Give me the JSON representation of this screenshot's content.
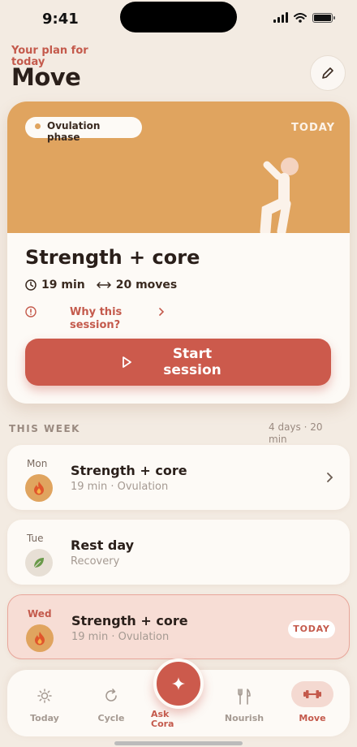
{
  "status_bar": {
    "time": "9:41"
  },
  "header": {
    "eyebrow": "Your plan for today",
    "title": "Move",
    "edit_icon": "pencil-icon"
  },
  "hero": {
    "phase": "Ovulation phase",
    "badge": "TODAY",
    "title": "Strength + core",
    "duration": "19 min",
    "moves": "20 moves",
    "why_label": "Why this session?",
    "start_label": "Start session",
    "banner_color": "#e0a45f",
    "accent_color": "#cc5a4c"
  },
  "week": {
    "heading": "THIS WEEK",
    "summary": "4 days · 20 min",
    "days": [
      {
        "day": "Mon",
        "title": "Strength + core",
        "subtitle": "19 min · Ovulation",
        "icon": "flame-icon"
      },
      {
        "day": "Tue",
        "title": "Rest day",
        "subtitle": "Recovery",
        "icon": "leaf-icon"
      },
      {
        "day": "Wed",
        "title": "Strength + core",
        "subtitle": "19 min · Ovulation",
        "icon": "flame-icon",
        "badge": "TODAY"
      }
    ]
  },
  "tabs": [
    {
      "label": "Today",
      "icon": "sun-icon"
    },
    {
      "label": "Cycle",
      "icon": "cycle-icon"
    },
    {
      "label": "Ask Cora",
      "icon": "sparkle-icon"
    },
    {
      "label": "Nourish",
      "icon": "utensils-icon"
    },
    {
      "label": "Move",
      "icon": "dumbbell-icon",
      "active": true
    }
  ]
}
